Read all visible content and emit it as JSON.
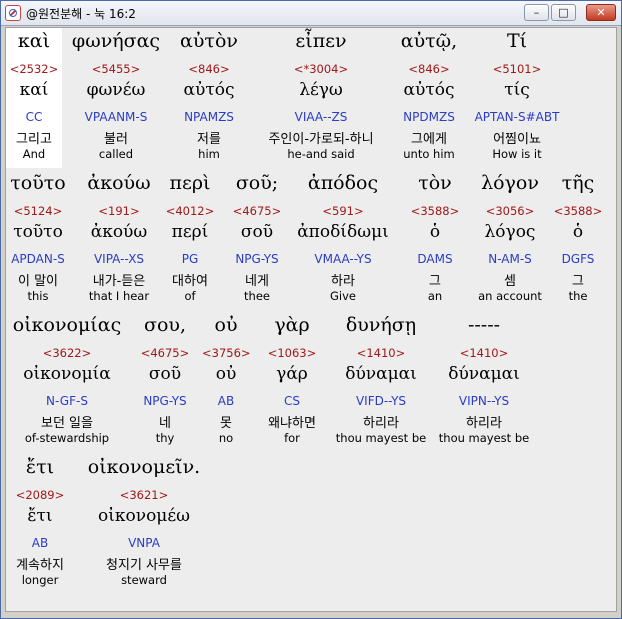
{
  "window": {
    "title": "@원전분해 - 눅 16:2",
    "buttons": {
      "minimize": "–",
      "maximize": "□",
      "close": "✕"
    },
    "icon": "book-app-icon"
  },
  "rows": [
    [
      {
        "greek": "καὶ",
        "strong": "<2532>",
        "lemma": "καί",
        "parsing": "CC",
        "korean": "그리고",
        "english": "And"
      },
      {
        "greek": "φωνήσας",
        "strong": "<5455>",
        "lemma": "φωνέω",
        "parsing": "VPAANM-S",
        "korean": "불러",
        "english": "called"
      },
      {
        "greek": "αὐτὸν",
        "strong": "<846>",
        "lemma": "αὐτός",
        "parsing": "NPAMZS",
        "korean": "저를",
        "english": "him"
      },
      {
        "greek": "εἶπεν",
        "strong": "<*3004>",
        "lemma": "λέγω",
        "parsing": "VIAA--ZS",
        "korean": "주인이-가로되-하니",
        "english": "he-and said"
      },
      {
        "greek": "αὐτῷ,",
        "strong": "<846>",
        "lemma": "αὐτός",
        "parsing": "NPDMZS",
        "korean": "그에게",
        "english": "unto him"
      },
      {
        "greek": "Τί",
        "strong": "<5101>",
        "lemma": "τίς",
        "parsing": "APTAN-S#ABT",
        "korean": "어찜이뇨",
        "english": "How is it"
      }
    ],
    [
      {
        "greek": "τοῦτο",
        "strong": "<5124>",
        "lemma": "τοῦτο",
        "parsing": "APDAN-S",
        "korean": "이 말이",
        "english": "this"
      },
      {
        "greek": "ἀκούω",
        "strong": "<191>",
        "lemma": "ἀκούω",
        "parsing": "VIPA--XS",
        "korean": "내가-듣은",
        "english": "that I hear"
      },
      {
        "greek": "περὶ",
        "strong": "<4012>",
        "lemma": "περί",
        "parsing": "PG",
        "korean": "대하여",
        "english": "of"
      },
      {
        "greek": "σοῦ;",
        "strong": "<4675>",
        "lemma": "σοῦ",
        "parsing": "NPG-YS",
        "korean": "네게",
        "english": "thee"
      },
      {
        "greek": "ἀπόδος",
        "strong": "<591>",
        "lemma": "ἀποδίδωμι",
        "parsing": "VMAA--YS",
        "korean": "하라",
        "english": "Give"
      },
      {
        "greek": "τὸν",
        "strong": "<3588>",
        "lemma": "ὁ",
        "parsing": "DAMS",
        "korean": "그",
        "english": "an"
      },
      {
        "greek": "λόγον",
        "strong": "<3056>",
        "lemma": "λόγος",
        "parsing": "N-AM-S",
        "korean": "셈",
        "english": "an account"
      },
      {
        "greek": "τῆς",
        "strong": "<3588>",
        "lemma": "ὁ",
        "parsing": "DGFS",
        "korean": "그",
        "english": "the"
      }
    ],
    [
      {
        "greek": "οἰκονομίας",
        "strong": "<3622>",
        "lemma": "οἰκονομία",
        "parsing": "N-GF-S",
        "korean": "보던 일을",
        "english": "of-stewardship"
      },
      {
        "greek": "σου,",
        "strong": "<4675>",
        "lemma": "σοῦ",
        "parsing": "NPG-YS",
        "korean": "네",
        "english": "thy"
      },
      {
        "greek": "οὐ",
        "strong": "<3756>",
        "lemma": "οὐ",
        "parsing": "AB",
        "korean": "못",
        "english": "no"
      },
      {
        "greek": "γὰρ",
        "strong": "<1063>",
        "lemma": "γάρ",
        "parsing": "CS",
        "korean": "왜냐하면",
        "english": "for"
      },
      {
        "greek": "δυνήσῃ",
        "strong": "<1410>",
        "lemma": "δύναμαι",
        "parsing": "VIFD--YS",
        "korean": "하리라",
        "english": "thou mayest be"
      },
      {
        "greek": "-----",
        "strong": "<1410>",
        "lemma": "δύναμαι",
        "parsing": "VIPN--YS",
        "korean": "하리라",
        "english": "thou mayest be"
      }
    ],
    [
      {
        "greek": "ἔτι",
        "strong": "<2089>",
        "lemma": "ἔτι",
        "parsing": "AB",
        "korean": "계속하지",
        "english": "longer"
      },
      {
        "greek": "οἰκονομεῖν.",
        "strong": "<3621>",
        "lemma": "οἰκονομέω",
        "parsing": "VNPA",
        "korean": "청지기 사무를",
        "english": "steward"
      }
    ]
  ]
}
